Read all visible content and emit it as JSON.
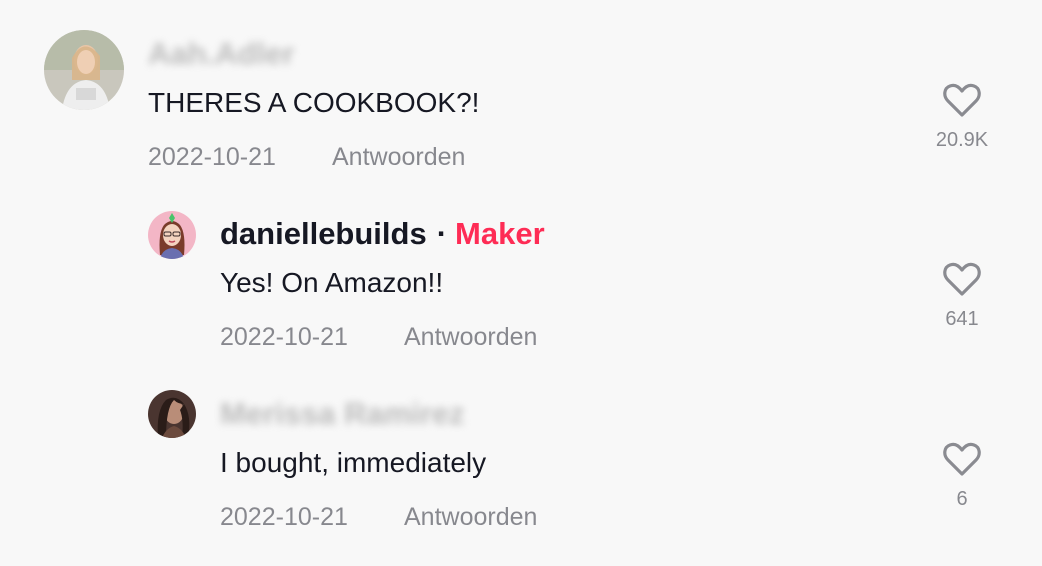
{
  "comments": [
    {
      "username": "Aah.Adler",
      "text": "THERES A COOKBOOK?!",
      "date": "2022-10-21",
      "reply_label": "Antwoorden",
      "likes": "20.9K"
    },
    {
      "username": "daniellebuilds",
      "separator": "·",
      "badge": "Maker",
      "text": "Yes! On Amazon!!",
      "date": "2022-10-21",
      "reply_label": "Antwoorden",
      "likes": "641"
    },
    {
      "username": "Merissa Ramirez",
      "text": "I bought, immediately",
      "date": "2022-10-21",
      "reply_label": "Antwoorden",
      "likes": "6"
    }
  ],
  "icons": {
    "like": "heart-outline-icon"
  },
  "colors": {
    "background": "#f8f8f8",
    "text": "#161823",
    "muted": "#8a8b91",
    "creator_badge": "#fe2c55"
  }
}
